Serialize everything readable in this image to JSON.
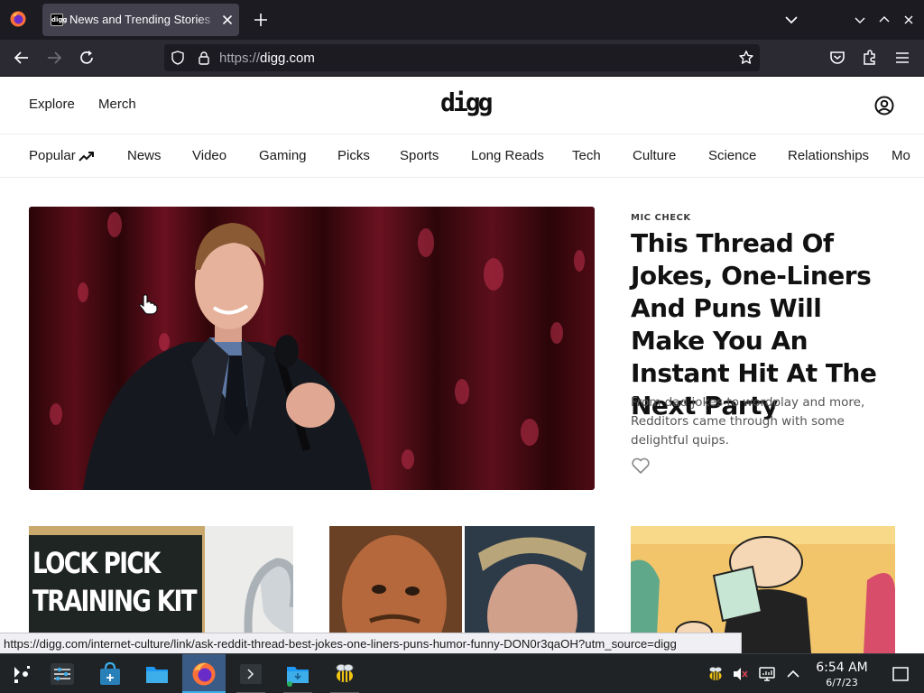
{
  "colors": {
    "chrome_dark": "#1c1b22",
    "chrome_toolbar": "#2b2a33",
    "tab_active": "#42414d",
    "taskbar": "#202326",
    "taskbar_active": "#3a5b85",
    "text_dark": "#111111"
  },
  "browser": {
    "tab": {
      "title": "News and Trending Stories",
      "favicon_text": "digg"
    },
    "url": {
      "scheme": "https://",
      "host": "digg.com"
    },
    "icons": [
      "firefox-icon",
      "close-icon",
      "plus-icon",
      "chevron-down-icon",
      "minimize-icon",
      "maximize-icon",
      "window-close-icon",
      "back-icon",
      "forward-icon",
      "reload-icon",
      "shield-icon",
      "lock-icon",
      "star-icon",
      "pocket-icon",
      "extensions-icon",
      "menu-icon"
    ]
  },
  "header": {
    "links": [
      "Explore",
      "Merch"
    ],
    "logo": "digg"
  },
  "nav": {
    "categories": [
      "Popular",
      "News",
      "Video",
      "Gaming",
      "Picks",
      "Sports",
      "Long Reads",
      "Tech",
      "Culture",
      "Science",
      "Relationships",
      "Mo"
    ]
  },
  "hero": {
    "kicker": "MIC CHECK",
    "headline": "This Thread Of Jokes, One-Liners And Puns Will Make You An Instant Hit At The Next Party",
    "dek": "From dad jokes to wordplay and more, Redditors came through with some delightful quips."
  },
  "cards": [
    {
      "image_text_line1": "LOCK PICK",
      "image_text_line2": "TRAINING KIT"
    },
    {
      "image": "fantasy-characters"
    },
    {
      "image": "cartoon-illustration"
    }
  ],
  "status": {
    "url": "https://digg.com/internet-culture/link/ask-reddit-thread-best-jokes-one-liners-puns-humor-funny-DON0r3qaOH?utm_source=digg"
  },
  "taskbar": {
    "apps": [
      "application-launcher",
      "system-settings",
      "discover",
      "file-manager",
      "firefox",
      "terminal",
      "downloads-folder",
      "bee-app"
    ],
    "clock": {
      "time": "6:54 AM",
      "date": "6/7/23"
    }
  }
}
